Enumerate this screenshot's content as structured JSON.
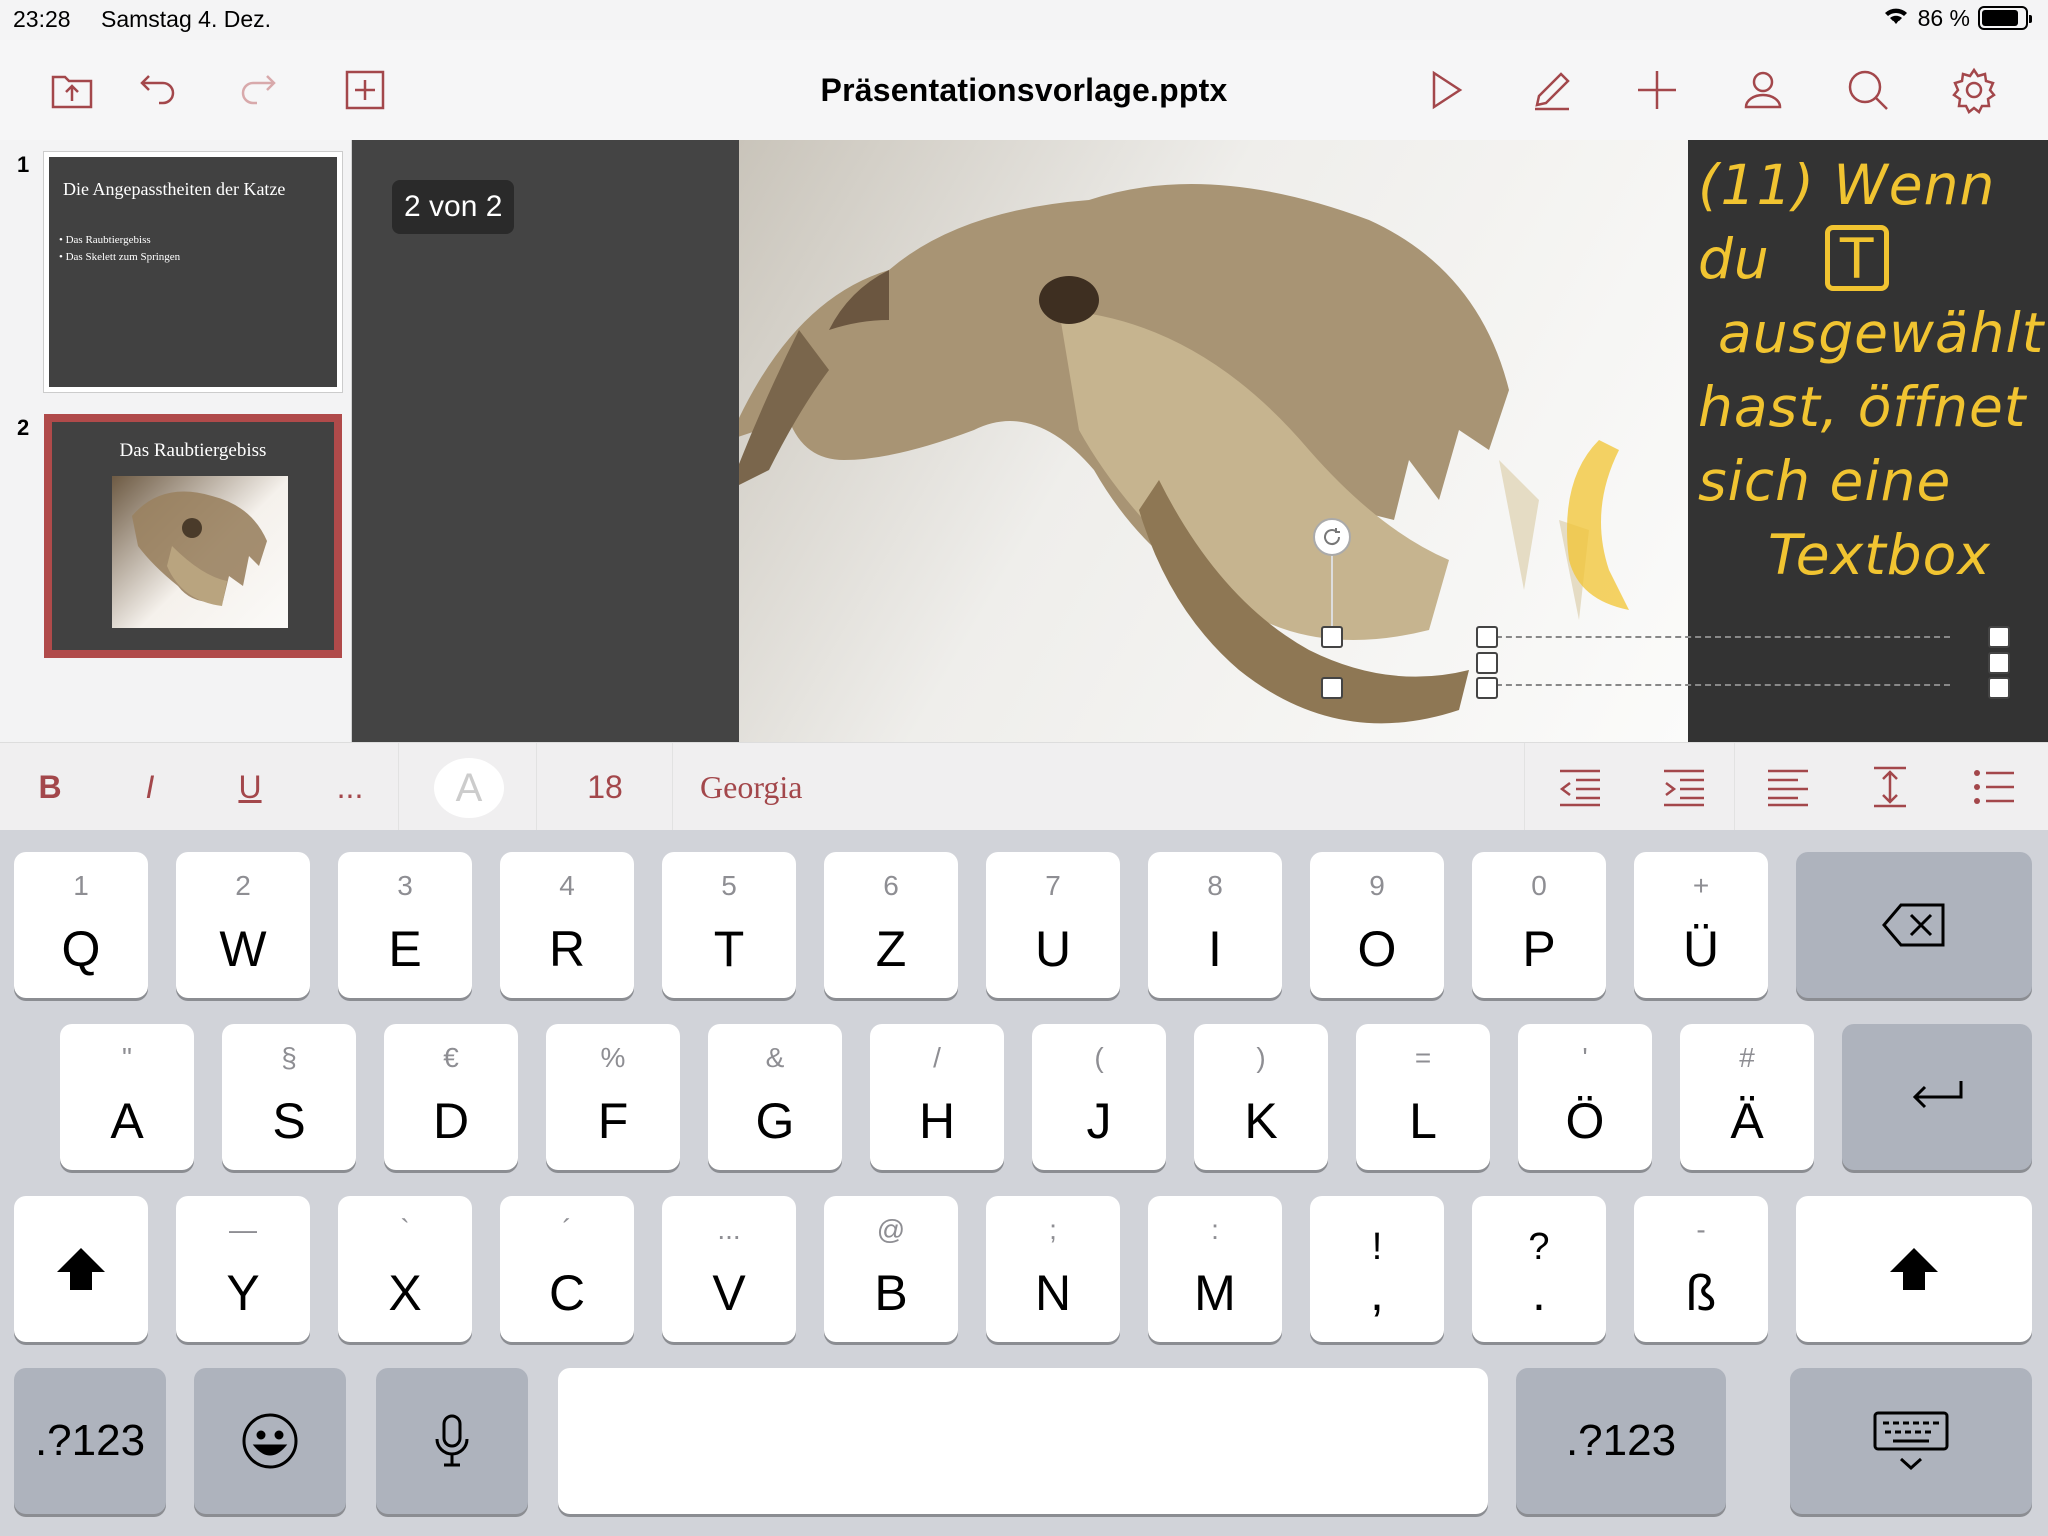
{
  "status_bar": {
    "time": "23:28",
    "date": "Samstag 4. Dez.",
    "battery_percent": "86 %",
    "battery_level": 0.86
  },
  "toolbar": {
    "title": "Präsentationsvorlage.pptx",
    "left_icons": [
      "folder-upload-icon",
      "undo-icon",
      "redo-icon",
      "add-slide-icon"
    ],
    "right_icons": [
      "play-icon",
      "pencil-icon",
      "plus-icon",
      "person-icon",
      "search-icon",
      "gear-icon"
    ],
    "accent": "#a3474b"
  },
  "slides": [
    {
      "number": "1",
      "title": "Die Angepasstheiten der Katze",
      "bullets": [
        "• Das Raubtiergebiss",
        "• Das Skelett zum Springen"
      ]
    },
    {
      "number": "2",
      "title": "Das Raubtiergebiss",
      "selected": true
    }
  ],
  "canvas": {
    "page_indicator": "2 von 2",
    "annotation_lines": [
      "(11) Wenn",
      "du",
      "T",
      "ausgewählt",
      "hast, öffnet",
      "sich eine",
      "Textbox"
    ]
  },
  "format_bar": {
    "bold": "B",
    "italic": "I",
    "underline": "U",
    "more": "...",
    "color_letter": "A",
    "font_size": "18",
    "font_name": "Georgia",
    "paragraph_icons": [
      "outdent-icon",
      "indent-icon",
      "align-left-icon",
      "line-spacing-icon",
      "bullet-list-icon"
    ]
  },
  "keyboard": {
    "row1": [
      {
        "main": "Q",
        "alt": "1"
      },
      {
        "main": "W",
        "alt": "2"
      },
      {
        "main": "E",
        "alt": "3"
      },
      {
        "main": "R",
        "alt": "4"
      },
      {
        "main": "T",
        "alt": "5"
      },
      {
        "main": "Z",
        "alt": "6"
      },
      {
        "main": "U",
        "alt": "7"
      },
      {
        "main": "I",
        "alt": "8"
      },
      {
        "main": "O",
        "alt": "9"
      },
      {
        "main": "P",
        "alt": "0"
      },
      {
        "main": "Ü",
        "alt": "+"
      }
    ],
    "row2": [
      {
        "main": "A",
        "alt": "\""
      },
      {
        "main": "S",
        "alt": "§"
      },
      {
        "main": "D",
        "alt": "€"
      },
      {
        "main": "F",
        "alt": "%"
      },
      {
        "main": "G",
        "alt": "&"
      },
      {
        "main": "H",
        "alt": "/"
      },
      {
        "main": "J",
        "alt": "("
      },
      {
        "main": "K",
        "alt": ")"
      },
      {
        "main": "L",
        "alt": "="
      },
      {
        "main": "Ö",
        "alt": "'"
      },
      {
        "main": "Ä",
        "alt": "#"
      }
    ],
    "row3": [
      {
        "main": "Y",
        "alt": "—"
      },
      {
        "main": "X",
        "alt": "`"
      },
      {
        "main": "C",
        "alt": "´"
      },
      {
        "main": "V",
        "alt": "..."
      },
      {
        "main": "B",
        "alt": "@"
      },
      {
        "main": "N",
        "alt": ";"
      },
      {
        "main": "M",
        "alt": ":"
      },
      {
        "main": ",",
        "alt": "!"
      },
      {
        "main": ".",
        "alt": "?"
      },
      {
        "main": "ß",
        "alt": "-"
      }
    ],
    "numbers_key": ".?123",
    "icons": [
      "backspace-icon",
      "return-icon",
      "shift-icon",
      "emoji-icon",
      "microphone-icon",
      "hide-keyboard-icon"
    ]
  }
}
